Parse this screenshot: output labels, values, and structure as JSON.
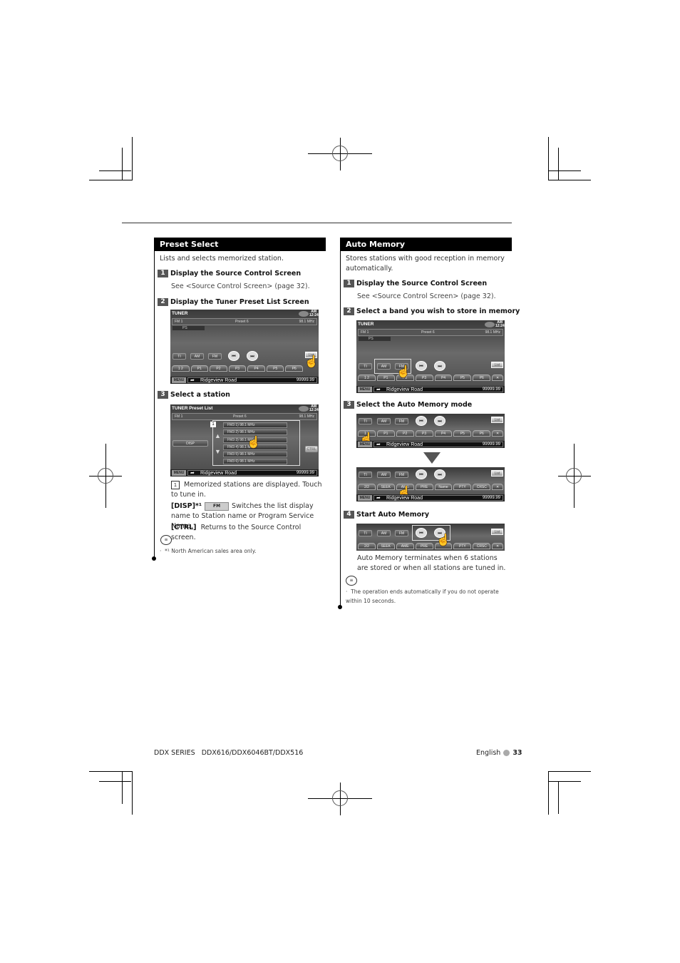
{
  "left": {
    "section_title": "Preset Select",
    "intro": "Lists and selects memorized station.",
    "steps": [
      {
        "num": "1",
        "title": "Display the Source Control Screen",
        "note": "See <Source Control Screen> (page 32)."
      },
      {
        "num": "2",
        "title": "Display the Tuner Preset List Screen"
      },
      {
        "num": "3",
        "title": "Select a station"
      }
    ],
    "screen1": {
      "title": "TUNER",
      "clock": "AM 12:24",
      "band": "FM 1",
      "preset": "Preset 6",
      "freq": "98.1 MHz",
      "ps": "PS",
      "buttons": [
        "TI",
        "AM",
        "FM"
      ],
      "seek_prev": "⏮",
      "seek_next": "⏭",
      "list_label": "List",
      "presets": [
        "1 2",
        "P1",
        "P2",
        "P3",
        "P4",
        "P5",
        "P6"
      ],
      "menu": "MENU",
      "road": "Ridgeview Road",
      "odo": "99999.99"
    },
    "screen2": {
      "title": "TUNER Preset List",
      "clock": "AM 12:24",
      "band": "FM 1",
      "preset": "Preset 6",
      "freq": "98.1 MHz",
      "disp": "DISP",
      "ctrl": "CTRL",
      "callout": "1",
      "items": [
        "FM3 1) 98.1 MHz",
        "FM3 2) 98.1 MHz",
        "FM3 3) 98.1 MHz",
        "FM3 4) 98.1 MHz",
        "FM3 5) 98.1 MHz",
        "FM3 6) 98.1 MHz"
      ],
      "menu": "MENU",
      "road": "Ridgeview Road",
      "odo": "99999.99"
    },
    "desc1_num": "1",
    "desc1": "Memorized stations are displayed. Touch to tune in.",
    "disp_key": "[DISP]*¹",
    "disp_badge": "FM",
    "disp_desc": "Switches the list display name to Station name or Program Service Name.",
    "ctrl_key": "[CTRL]",
    "ctrl_desc": "Returns to the Source Control screen.",
    "note": "*¹ North American sales area only."
  },
  "right": {
    "section_title": "Auto Memory",
    "intro": "Stores stations with good reception in memory automatically.",
    "steps": [
      {
        "num": "1",
        "title": "Display the Source Control Screen",
        "note": "See <Source Control Screen> (page 32)."
      },
      {
        "num": "2",
        "title": "Select a band you wish to store in memory"
      },
      {
        "num": "3",
        "title": "Select the Auto Memory mode"
      },
      {
        "num": "4",
        "title": "Start Auto Memory"
      }
    ],
    "screen1": {
      "title": "TUNER",
      "clock": "AM 12:24",
      "band": "FM 1",
      "preset": "Preset 6",
      "freq": "98.1 MHz",
      "ps": "PS",
      "buttons": [
        "TI",
        "AM",
        "FM"
      ],
      "list_label": "List",
      "presets": [
        "1 2",
        "P1",
        "P2",
        "P3",
        "P4",
        "P5",
        "P6",
        "✕"
      ],
      "menu": "MENU",
      "road": "Ridgeview Road",
      "odo": "99999.99"
    },
    "screen_mode_a": {
      "buttons": [
        "TI",
        "AM",
        "FM"
      ],
      "list_label": "List",
      "presets": [
        "1 2",
        "P1",
        "P2",
        "P3",
        "P4",
        "P5",
        "P6",
        "✕"
      ],
      "menu": "MENU",
      "road": "Ridgeview Road",
      "odo": "99999.99"
    },
    "screen_mode_b": {
      "buttons": [
        "TI",
        "AM",
        "FM"
      ],
      "list_label": "List",
      "functions": [
        "2/2",
        "SEEK",
        "AME",
        "PRE",
        "Name",
        "PTY",
        "CRSC",
        "✕"
      ],
      "menu": "MENU",
      "road": "Ridgeview Road",
      "odo": "99999.99"
    },
    "screen_start": {
      "buttons": [
        "TI",
        "AM",
        "FM"
      ],
      "list_label": "List",
      "functions": [
        "2/2",
        "SEEK",
        "AME",
        "PRE",
        "",
        "PTY",
        "CRSC",
        "✕"
      ]
    },
    "result": "Auto Memory terminates when 6 stations are stored or when all stations are tuned in.",
    "note": "The operation ends automatically if you do not operate within 10 seconds."
  },
  "footer": {
    "series": "DDX SERIES",
    "models": "DDX616/DDX6046BT/DDX516",
    "language": "English",
    "page": "33"
  }
}
